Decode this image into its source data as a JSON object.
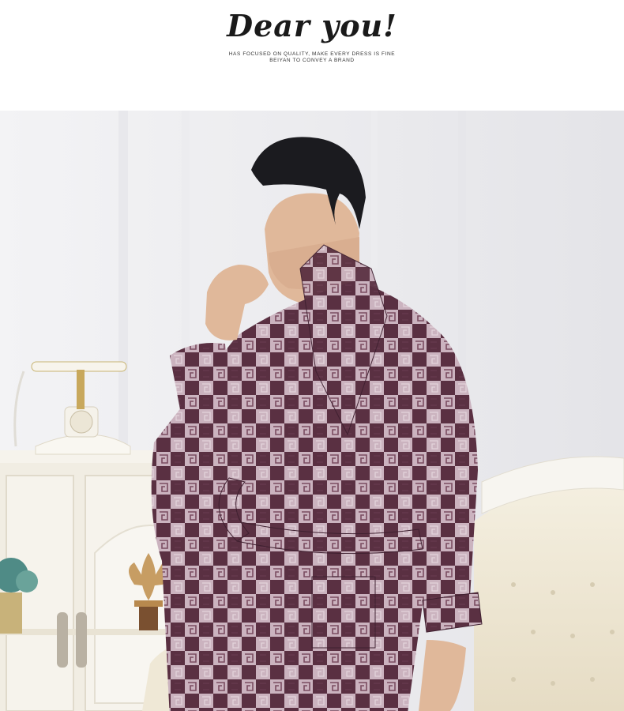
{
  "header": {
    "headline": "Dear you!",
    "tagline_line1": "HAS FOCUSED ON QUALITY, MAKE EVERY DRESS IS FINE",
    "tagline_line2": "BEIYAN TO CONVEY A BRAND"
  },
  "photo": {
    "subject": "man-in-checkered-bathrobe",
    "colors": {
      "robe_dark": "#5a3042",
      "robe_light": "#cbb3bf",
      "wall": "#eeeef0",
      "cabinet": "#f3f0e8",
      "sofa": "#efe8d6",
      "skin": "#e0b89a",
      "hair": "#1b1b1f"
    }
  }
}
